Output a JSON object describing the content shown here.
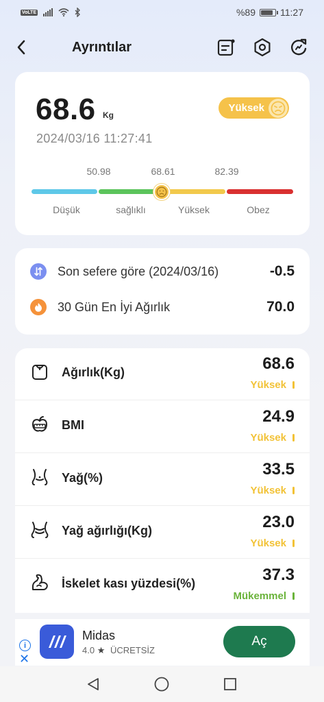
{
  "status_bar": {
    "volte": "VoLTE",
    "battery_text": "%89",
    "battery_level": 0.89,
    "time": "11:27"
  },
  "header": {
    "title": "Ayrıntılar",
    "back_icon": "chevron-left-icon",
    "icons": [
      "report-icon",
      "settings-hexagon-icon",
      "refresh-icon"
    ]
  },
  "summary": {
    "weight": "68.6",
    "unit": "Kg",
    "datetime": "2024/03/16 11:27:41",
    "status": "Yüksek",
    "status_color": "#f5c24a",
    "thresholds": [
      "50.98",
      "68.61",
      "82.39"
    ],
    "segments": [
      {
        "label": "Düşük",
        "color": "#5ec8e8"
      },
      {
        "label": "sağlıklı",
        "color": "#5cc45c"
      },
      {
        "label": "Yüksek",
        "color": "#f2c94c"
      },
      {
        "label": "Obez",
        "color": "#d93030"
      }
    ]
  },
  "comparison": [
    {
      "label": "Son sefere göre (2024/03/16)",
      "value": "-0.5",
      "icon": "compare-arrows-icon",
      "icon_color": "#7b8ff0"
    },
    {
      "label": "30 Gün En İyi Ağırlık",
      "value": "70.0",
      "icon": "flame-icon",
      "icon_color": "#f5923a"
    }
  ],
  "metrics": [
    {
      "label": "Ağırlık(Kg)",
      "value": "68.6",
      "status": "Yüksek",
      "status_color": "#f2c236",
      "icon": "scale-icon"
    },
    {
      "label": "BMI",
      "value": "24.9",
      "status": "Yüksek",
      "status_color": "#f2c236",
      "icon": "apple-measure-icon"
    },
    {
      "label": "Yağ(%)",
      "value": "33.5",
      "status": "Yüksek",
      "status_color": "#f2c236",
      "icon": "body-fat-icon"
    },
    {
      "label": "Yağ ağırlığı(Kg)",
      "value": "23.0",
      "status": "Yüksek",
      "status_color": "#f2c236",
      "icon": "body-fat-weight-icon"
    },
    {
      "label": "İskelet kası yüzdesi(%)",
      "value": "37.3",
      "status": "Mükemmel",
      "status_color": "#6ab33a",
      "icon": "muscle-arm-icon"
    }
  ],
  "ad": {
    "app_name": "Midas",
    "rating": "4.0",
    "price": "ÜCRETSİZ",
    "button": "Aç"
  }
}
